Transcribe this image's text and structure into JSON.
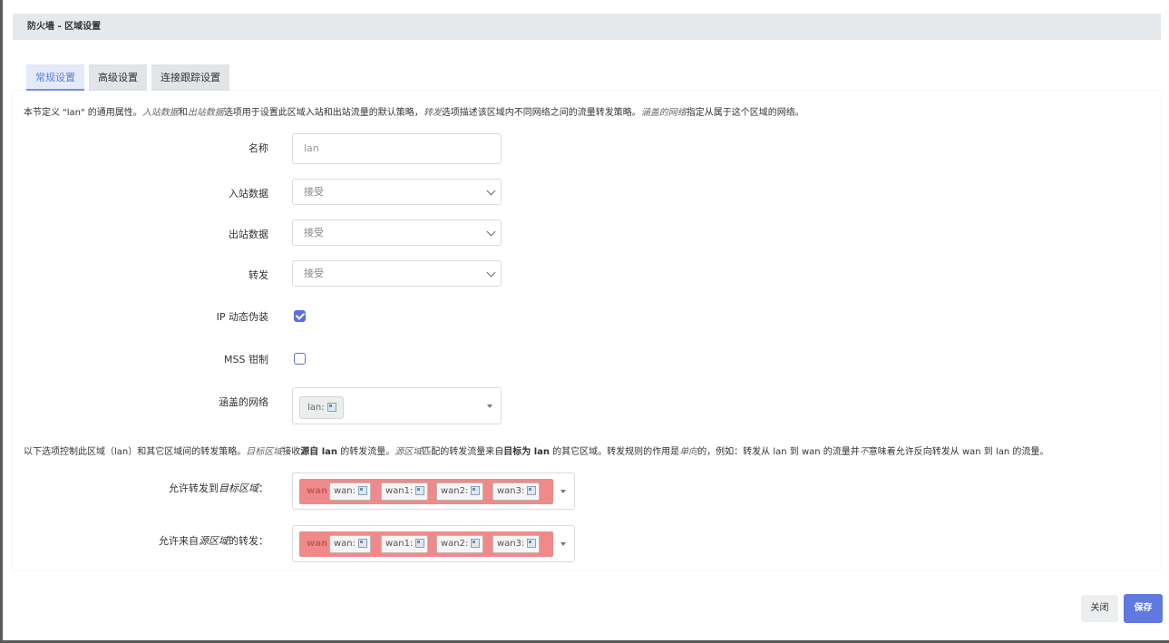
{
  "modal": {
    "title": "防火墙 - 区域设置"
  },
  "tabs": [
    {
      "label": "常规设置",
      "active": true
    },
    {
      "label": "高级设置",
      "active": false
    },
    {
      "label": "连接跟踪设置",
      "active": false
    }
  ],
  "description1": {
    "p1": "本节定义 \"lan\" 的通用属性。",
    "i1": "入站数据",
    "p2": "和",
    "i2": "出站数据",
    "p3": "选项用于设置此区域入站和出站流量的默认策略，",
    "i3": "转发",
    "p4": "选项描述该区域内不同网络之间的流量转发策略。",
    "i4": "涵盖的网络",
    "p5": "指定从属于这个区域的网络。"
  },
  "fields": {
    "name": {
      "label": "名称",
      "value": "lan"
    },
    "input": {
      "label": "入站数据",
      "value": "接受"
    },
    "output": {
      "label": "出站数据",
      "value": "接受"
    },
    "forward": {
      "label": "转发",
      "value": "接受"
    },
    "masq": {
      "label": "IP 动态伪装",
      "checked": true
    },
    "mss": {
      "label": "MSS 钳制",
      "checked": false
    },
    "networks": {
      "label": "涵盖的网络",
      "chips": [
        "lan:"
      ]
    }
  },
  "description2": {
    "p1": "以下选项控制此区域（lan）和其它区域间的转发策略。",
    "i1": "目标区域",
    "p2": "接收",
    "b1": "源自 lan",
    "p3": " 的转发流量。",
    "i2": "源区域",
    "p4": "匹配的转发流量来自",
    "b2": "目标为 lan",
    "p5": " 的其它区域。转发规则的作用是",
    "i3": "单向",
    "p6": "的，例如：转发从 lan 到 wan 的流量并",
    "i4": "不",
    "p7": "意味着允许反向转发从 wan 到 lan 的流量。"
  },
  "forward_dest": {
    "label_prefix": "允许转发到",
    "label_italic": "目标区域",
    "label_suffix": "：",
    "zone": "wan",
    "networks": [
      "wan:",
      "wan1:",
      "wan2:",
      "wan3:"
    ]
  },
  "forward_src": {
    "label_prefix": "允许来自",
    "label_italic": "源区域",
    "label_suffix": "的转发：",
    "zone": "wan",
    "networks": [
      "wan:",
      "wan1:",
      "wan2:",
      "wan3:"
    ]
  },
  "buttons": {
    "close": "关闭",
    "save": "保存"
  },
  "colors": {
    "accent": "#6079e0",
    "zone_wan": "#f08a8a"
  }
}
